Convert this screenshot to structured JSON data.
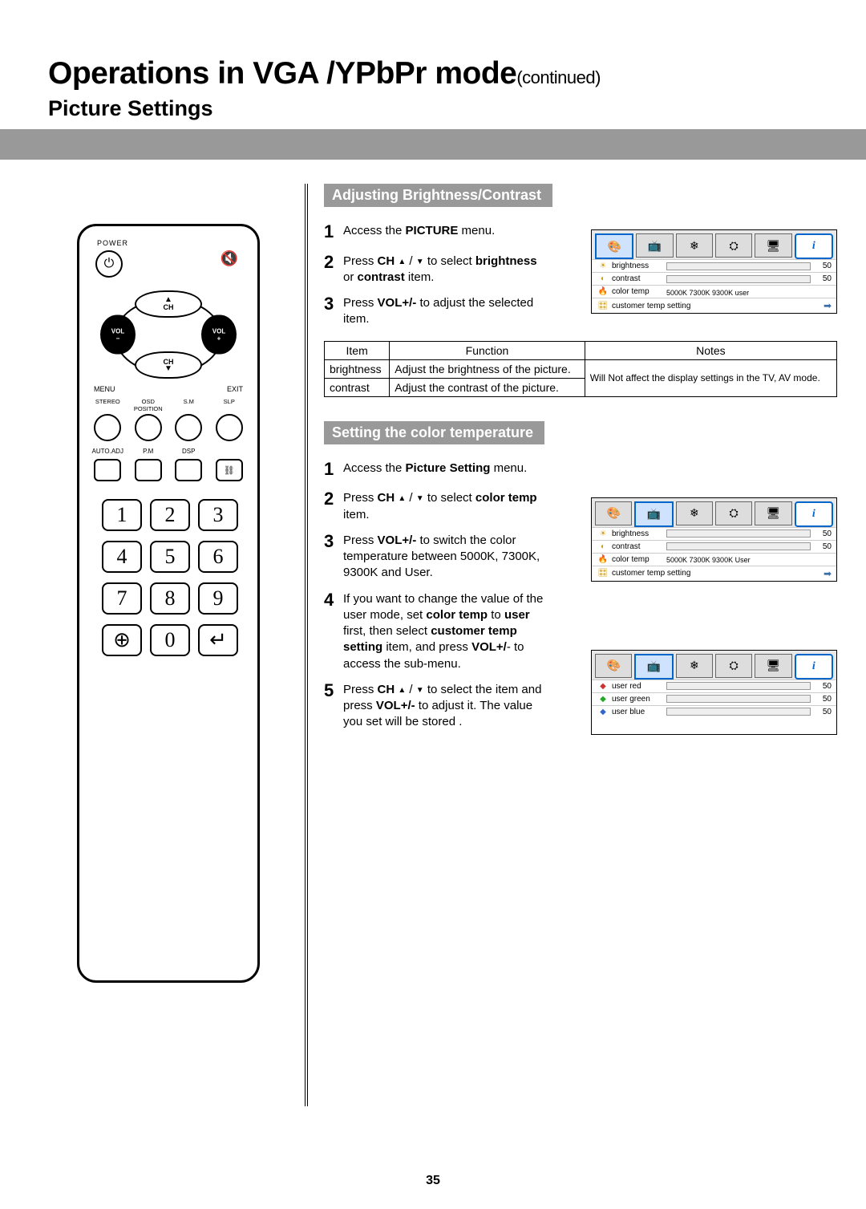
{
  "page_number": "35",
  "title_main": "Operations in VGA /YPbPr mode",
  "title_cont": "(continued)",
  "subtitle": "Picture Settings",
  "remote": {
    "power_label": "POWER",
    "ch_label": "CH",
    "vol_minus": "VOL\n−",
    "vol_plus": "VOL\n+",
    "menu": "MENU",
    "exit": "EXIT",
    "row4_labels": [
      "STEREO",
      "OSD\nPOSITION",
      "S.M",
      "SLP"
    ],
    "row5_labels": [
      "AUTO.ADJ",
      "P.M",
      "DSP",
      ""
    ],
    "row5_last_glyph": "⛓",
    "numpad": [
      "1",
      "2",
      "3",
      "4",
      "5",
      "6",
      "7",
      "8",
      "9",
      "⊕",
      "0",
      "↵"
    ]
  },
  "sectionA": {
    "heading": "Adjusting Brightness/Contrast",
    "steps": [
      {
        "n": "1",
        "html": "Access the <b>PICTURE</b> menu."
      },
      {
        "n": "2",
        "html": "Press <b>CH</b> <span class='arrowglyph'>▲</span> / <span class='arrowglyph'>▼</span> to select <b>brightness</b> or <b>contrast</b> item."
      },
      {
        "n": "3",
        "html": "Press <b>VOL+/-</b> to adjust the selected item."
      }
    ],
    "table": {
      "headers": [
        "Item",
        "Function",
        "Notes"
      ],
      "rows": [
        {
          "item": "brightness",
          "func": "Adjust the brightness of the picture."
        },
        {
          "item": "contrast",
          "func": "Adjust the contrast of the picture."
        }
      ],
      "note": "Will Not affect the display settings in the TV, AV mode."
    }
  },
  "sectionB": {
    "heading": "Setting the color temperature",
    "steps": [
      {
        "n": "1",
        "html": "Access the <b>Picture Setting</b> menu."
      },
      {
        "n": "2",
        "html": "Press <b>CH</b> <span class='arrowglyph'>▲</span> / <span class='arrowglyph'>▼</span> to select <b>color temp</b> item."
      },
      {
        "n": "3",
        "html": "Press <b>VOL+/-</b> to switch the color temperature between 5000K, 7300K, 9300K and User."
      },
      {
        "n": "4",
        "html": "If you want to change the value of the user mode, set <b>color temp</b> to <b>user</b> first, then select <b>customer temp setting</b> item, and press <b>VOL+/</b>- to access the sub-menu."
      },
      {
        "n": "5",
        "html": "Press <b>CH</b> <span class='arrowglyph'>▲</span> / <span class='arrowglyph'>▼</span> to select the item and press <b>VOL+/-</b> to adjust it. The value you set will be stored ."
      }
    ]
  },
  "osd1": {
    "brightness_label": "brightness",
    "brightness_val": "50",
    "contrast_label": "contrast",
    "contrast_val": "50",
    "colortemp_label": "color temp",
    "temps": "5000K 7300K 9300K user",
    "cust_label": "customer temp setting"
  },
  "osd2": {
    "brightness_label": "brightness",
    "brightness_val": "50",
    "contrast_label": "contrast",
    "contrast_val": "50",
    "colortemp_label": "color temp",
    "temps": "5000K 7300K 9300K User",
    "cust_label": "customer temp setting"
  },
  "osd3": {
    "rows": [
      {
        "label": "user red",
        "val": "50",
        "ico_color": "#c33"
      },
      {
        "label": "user green",
        "val": "50",
        "ico_color": "#2a2"
      },
      {
        "label": "user blue",
        "val": "50",
        "ico_color": "#36c"
      }
    ]
  },
  "icons": {
    "tab_icons": [
      "🎨",
      "📺",
      "⚙",
      "⛭",
      "🖥",
      "ℹ"
    ]
  }
}
